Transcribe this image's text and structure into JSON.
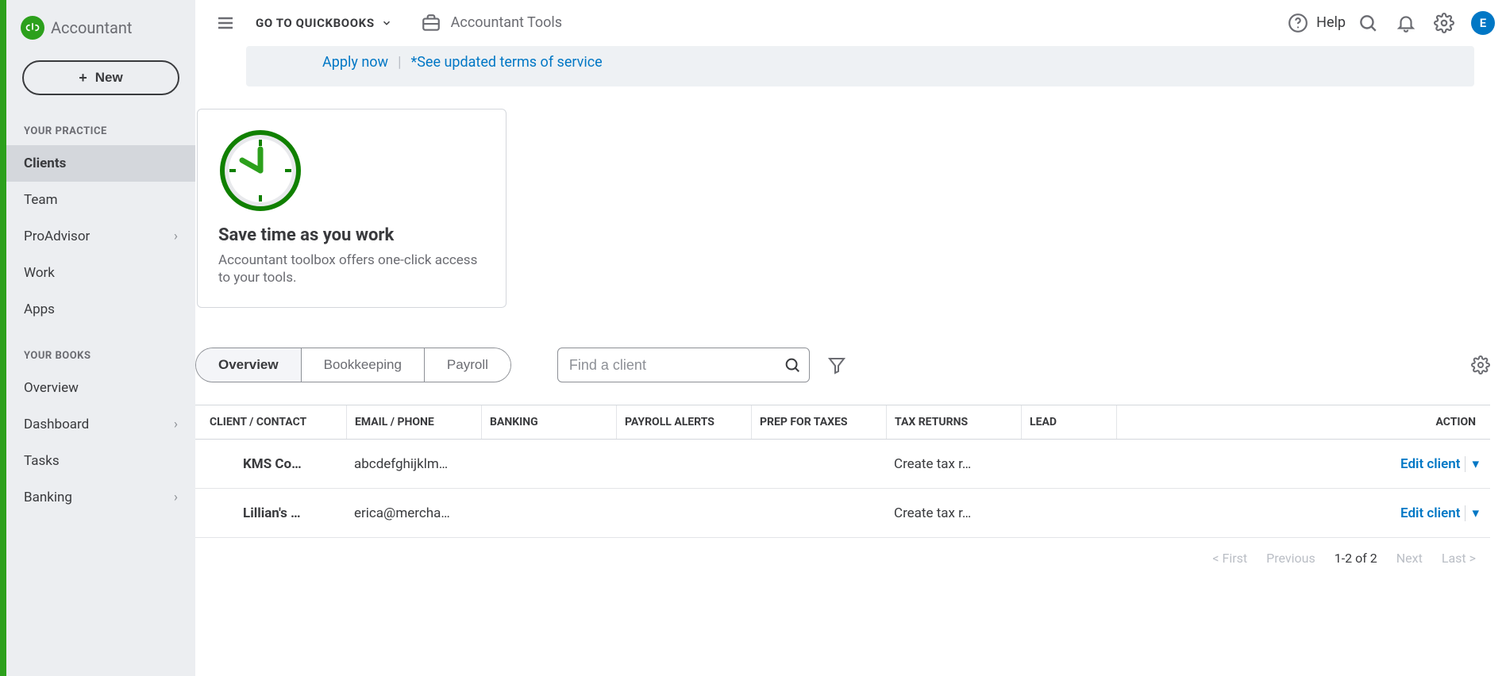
{
  "logo_text": "Accountant",
  "new_button": "New",
  "sidebar": {
    "section1": "YOUR PRACTICE",
    "items1": [
      "Clients",
      "Team",
      "ProAdvisor",
      "Work",
      "Apps"
    ],
    "section2": "YOUR BOOKS",
    "items2": [
      "Overview",
      "Dashboard",
      "Tasks",
      "Banking"
    ]
  },
  "topbar": {
    "goto": "GO TO QUICKBOOKS",
    "atools": "Accountant Tools",
    "help": "Help",
    "avatar": "E"
  },
  "banner": {
    "apply": "Apply now",
    "terms": "*See updated terms of service"
  },
  "card": {
    "title": "Save time as you work",
    "desc": "Accountant toolbox offers one-click access to your tools."
  },
  "tabs": {
    "overview": "Overview",
    "bookkeeping": "Bookkeeping",
    "payroll": "Payroll"
  },
  "search_placeholder": "Find a client",
  "columns": {
    "client": "CLIENT / CONTACT",
    "email": "EMAIL / PHONE",
    "banking": "BANKING",
    "payroll": "PAYROLL ALERTS",
    "prep": "PREP FOR TAXES",
    "taxret": "TAX RETURNS",
    "lead": "LEAD",
    "action": "ACTION"
  },
  "rows": [
    {
      "client": "KMS Co…",
      "email": "abcdefghijklm…",
      "tax": "Create tax r…",
      "action": "Edit client"
    },
    {
      "client": "Lillian's …",
      "email": "erica@mercha…",
      "tax": "Create tax r…",
      "action": "Edit client"
    }
  ],
  "pager": {
    "first": "< First",
    "prev": "Previous",
    "range": "1-2 of 2",
    "next": "Next",
    "last": "Last >"
  }
}
